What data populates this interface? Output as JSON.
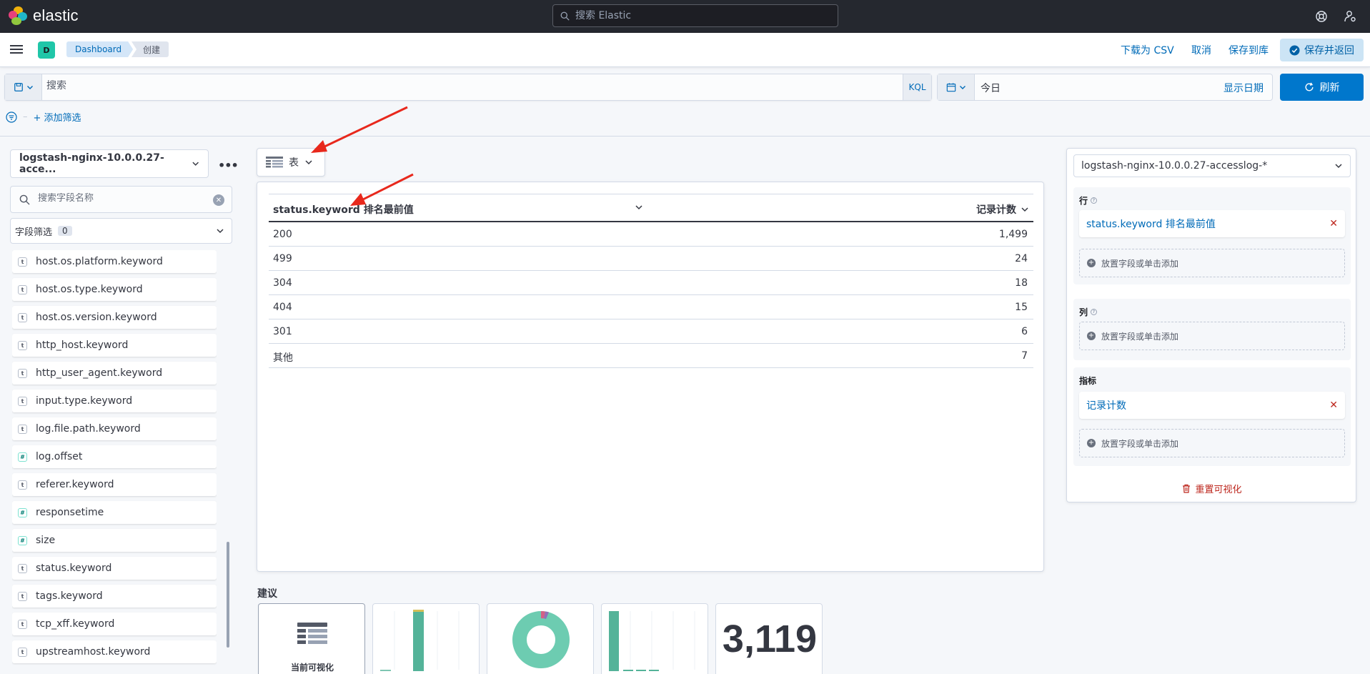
{
  "app": {
    "logo_text": "elastic",
    "search_placeholder": "搜索 Elastic"
  },
  "breadcrumbs": [
    "Dashboard",
    "创建"
  ],
  "space_avatar": "D",
  "header_actions": {
    "download_csv": "下载为 CSV",
    "cancel": "取消",
    "save_to_library": "保存到库",
    "save_and_return": "保存并返回"
  },
  "query": {
    "placeholder": "搜索",
    "language": "KQL",
    "date_text": "今日",
    "show_dates": "显示日期",
    "refresh": "刷新",
    "add_filter": "+ 添加筛选"
  },
  "left_panel": {
    "index_pattern": "logstash-nginx-10.0.0.27-acce...",
    "field_search_placeholder": "搜索字段名称",
    "field_filter_label": "字段筛选",
    "field_filter_count": "0",
    "fields": [
      {
        "name": "host.os.platform.keyword",
        "type": "t"
      },
      {
        "name": "host.os.type.keyword",
        "type": "t"
      },
      {
        "name": "host.os.version.keyword",
        "type": "t"
      },
      {
        "name": "http_host.keyword",
        "type": "t"
      },
      {
        "name": "http_user_agent.keyword",
        "type": "t"
      },
      {
        "name": "input.type.keyword",
        "type": "t"
      },
      {
        "name": "log.file.path.keyword",
        "type": "t"
      },
      {
        "name": "log.offset",
        "type": "#"
      },
      {
        "name": "referer.keyword",
        "type": "t"
      },
      {
        "name": "responsetime",
        "type": "#"
      },
      {
        "name": "size",
        "type": "#"
      },
      {
        "name": "status.keyword",
        "type": "t"
      },
      {
        "name": "tags.keyword",
        "type": "t"
      },
      {
        "name": "tcp_xff.keyword",
        "type": "t"
      },
      {
        "name": "upstreamhost.keyword",
        "type": "t"
      }
    ]
  },
  "viz_switch": {
    "label": "表"
  },
  "table": {
    "col1": "status.keyword 排名最前值",
    "col2": "记录计数",
    "rows": [
      {
        "key": "200",
        "count": "1,499"
      },
      {
        "key": "499",
        "count": "24"
      },
      {
        "key": "304",
        "count": "18"
      },
      {
        "key": "404",
        "count": "15"
      },
      {
        "key": "301",
        "count": "6"
      },
      {
        "key": "其他",
        "count": "7"
      }
    ]
  },
  "suggestions": {
    "title": "建议",
    "current_label": "当前可视化",
    "metric_value": "3,119"
  },
  "config": {
    "index_pattern": "logstash-nginx-10.0.0.27-accesslog-*",
    "rows_label": "行",
    "rows_field": "status.keyword 排名最前值",
    "columns_label": "列",
    "metrics_label": "指标",
    "metrics_field": "记录计数",
    "drop_hint": "放置字段或单击添加",
    "reset": "重置可视化"
  },
  "colors": {
    "header_bg": "#25282f",
    "primary": "#0077cc",
    "link": "#006bb8",
    "danger": "#bd271e",
    "teal": "#54b399"
  }
}
